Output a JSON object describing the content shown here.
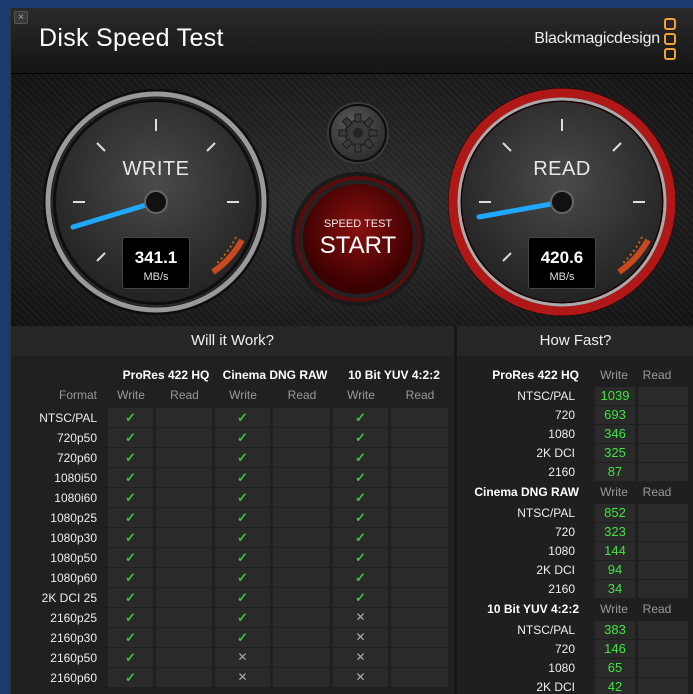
{
  "window": {
    "close_label": "×",
    "title": "Disk Speed Test",
    "brand": "Blackmagicdesign"
  },
  "write_gauge": {
    "label": "WRITE",
    "value": "341.1",
    "unit": "MB/s"
  },
  "read_gauge": {
    "label": "READ",
    "value": "420.6",
    "unit": "MB/s"
  },
  "start_button": {
    "small": "SPEED TEST",
    "big": "START"
  },
  "will_it_work": {
    "heading": "Will it Work?",
    "format_label": "Format",
    "groups": [
      "ProRes 422 HQ",
      "Cinema DNG RAW",
      "10 Bit YUV 4:2:2"
    ],
    "subheads": [
      "Write",
      "Read"
    ],
    "rows": [
      {
        "format": "NTSC/PAL",
        "marks": [
          "ok",
          "",
          "ok",
          "",
          "ok",
          ""
        ]
      },
      {
        "format": "720p50",
        "marks": [
          "ok",
          "",
          "ok",
          "",
          "ok",
          ""
        ]
      },
      {
        "format": "720p60",
        "marks": [
          "ok",
          "",
          "ok",
          "",
          "ok",
          ""
        ]
      },
      {
        "format": "1080i50",
        "marks": [
          "ok",
          "",
          "ok",
          "",
          "ok",
          ""
        ]
      },
      {
        "format": "1080i60",
        "marks": [
          "ok",
          "",
          "ok",
          "",
          "ok",
          ""
        ]
      },
      {
        "format": "1080p25",
        "marks": [
          "ok",
          "",
          "ok",
          "",
          "ok",
          ""
        ]
      },
      {
        "format": "1080p30",
        "marks": [
          "ok",
          "",
          "ok",
          "",
          "ok",
          ""
        ]
      },
      {
        "format": "1080p50",
        "marks": [
          "ok",
          "",
          "ok",
          "",
          "ok",
          ""
        ]
      },
      {
        "format": "1080p60",
        "marks": [
          "ok",
          "",
          "ok",
          "",
          "ok",
          ""
        ]
      },
      {
        "format": "2K DCI 25",
        "marks": [
          "ok",
          "",
          "ok",
          "",
          "ok",
          ""
        ]
      },
      {
        "format": "2160p25",
        "marks": [
          "ok",
          "",
          "ok",
          "",
          "no",
          ""
        ]
      },
      {
        "format": "2160p30",
        "marks": [
          "ok",
          "",
          "ok",
          "",
          "no",
          ""
        ]
      },
      {
        "format": "2160p50",
        "marks": [
          "ok",
          "",
          "no",
          "",
          "no",
          ""
        ]
      },
      {
        "format": "2160p60",
        "marks": [
          "ok",
          "",
          "no",
          "",
          "no",
          ""
        ]
      }
    ]
  },
  "how_fast": {
    "heading": "How Fast?",
    "write_label": "Write",
    "read_label": "Read",
    "groups": [
      {
        "name": "ProRes 422 HQ",
        "rows": [
          {
            "format": "NTSC/PAL",
            "write": "1039"
          },
          {
            "format": "720",
            "write": "693"
          },
          {
            "format": "1080",
            "write": "346"
          },
          {
            "format": "2K DCI",
            "write": "325"
          },
          {
            "format": "2160",
            "write": "87"
          }
        ]
      },
      {
        "name": "Cinema DNG RAW",
        "rows": [
          {
            "format": "NTSC/PAL",
            "write": "852"
          },
          {
            "format": "720",
            "write": "323"
          },
          {
            "format": "1080",
            "write": "144"
          },
          {
            "format": "2K DCI",
            "write": "94"
          },
          {
            "format": "2160",
            "write": "34"
          }
        ]
      },
      {
        "name": "10 Bit YUV 4:2:2",
        "rows": [
          {
            "format": "NTSC/PAL",
            "write": "383"
          },
          {
            "format": "720",
            "write": "146"
          },
          {
            "format": "1080",
            "write": "65"
          },
          {
            "format": "2K DCI",
            "write": "42"
          }
        ]
      }
    ]
  },
  "icons": {
    "ok": "✓",
    "no": "✕",
    "settings": "gear-icon"
  },
  "colors": {
    "accent_blue": "#1ea8ff",
    "read_ring": "#b01818",
    "value_green": "#3ee63e",
    "check_green": "#3ac43a"
  }
}
